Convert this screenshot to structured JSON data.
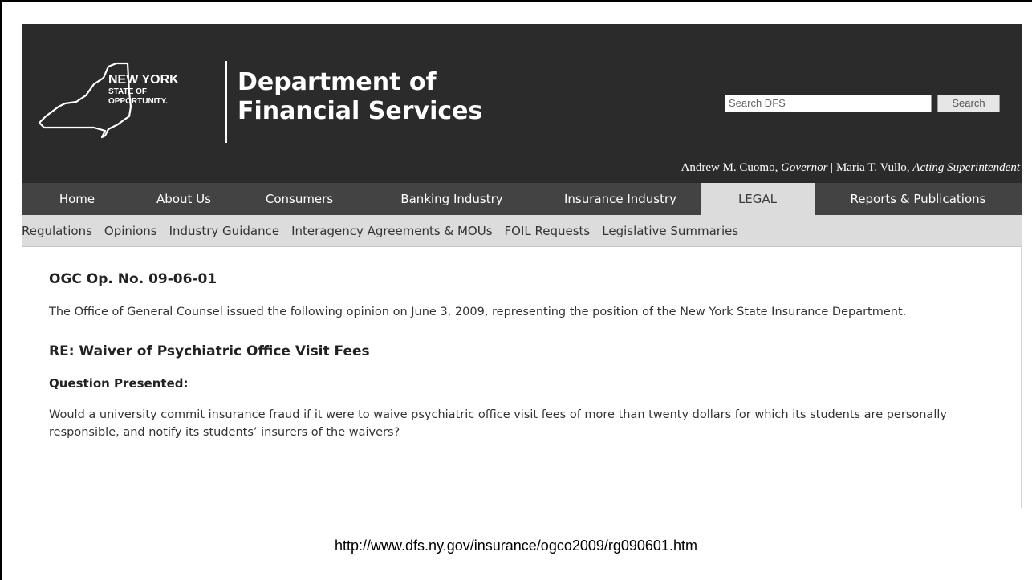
{
  "header": {
    "logo": {
      "line1": "NEW YORK",
      "line2": "STATE OF",
      "line3": "OPPORTUNITY."
    },
    "department_line1": "Department of",
    "department_line2": "Financial Services",
    "search_placeholder": "Search DFS",
    "search_button": "Search",
    "governor_name": "Andrew M. Cuomo, ",
    "governor_title": "Governor",
    "separator": " | ",
    "superintendent_name": "Maria T. Vullo, ",
    "superintendent_title": "Acting Superintendent"
  },
  "nav": {
    "items": [
      {
        "label": "Home"
      },
      {
        "label": "About Us"
      },
      {
        "label": "Consumers"
      },
      {
        "label": "Banking Industry"
      },
      {
        "label": "Insurance Industry"
      },
      {
        "label": "LEGAL"
      },
      {
        "label": "Reports & Publications"
      }
    ]
  },
  "subnav": {
    "items": [
      {
        "label": "Regulations"
      },
      {
        "label": "Opinions"
      },
      {
        "label": "Industry Guidance"
      },
      {
        "label": "Interagency Agreements & MOUs"
      },
      {
        "label": "FOIL Requests"
      },
      {
        "label": "Legislative Summaries"
      }
    ]
  },
  "content": {
    "op_number": "OGC Op. No. 09-06-01",
    "intro": "The Office of General Counsel issued the following opinion on June 3, 2009, representing the position of the New York State Insurance Department.",
    "re_title": "RE: Waiver of Psychiatric Office Visit Fees",
    "question_head": "Question Presented:",
    "question": "Would a university commit insurance fraud if it were to waive psychiatric office visit fees of more than twenty dollars for which its students are personally responsible, and notify its students’ insurers of the waivers?"
  },
  "footer": {
    "url": "http://www.dfs.ny.gov/insurance/ogco2009/rg090601.htm"
  }
}
